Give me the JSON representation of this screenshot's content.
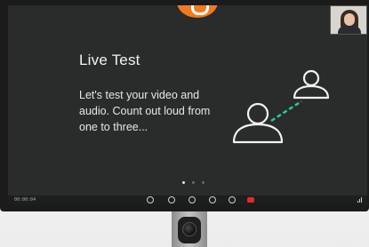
{
  "slide": {
    "title": "Live Test",
    "body": "Let's test your video and audio. Count out loud from one to three..."
  },
  "toolbar": {
    "call_time": "00:00:04",
    "icons": [
      "video-icon",
      "microphone-icon",
      "speaker-icon",
      "share-screen-icon",
      "more-icon",
      "hang-up-icon"
    ]
  },
  "pagination": {
    "count": 3,
    "active": 1
  },
  "colors": {
    "screen_bg": "#2a2b2b",
    "accent_line": "#2ec4a0",
    "hangup": "#e02b2b",
    "logo": "#f07b1f"
  }
}
